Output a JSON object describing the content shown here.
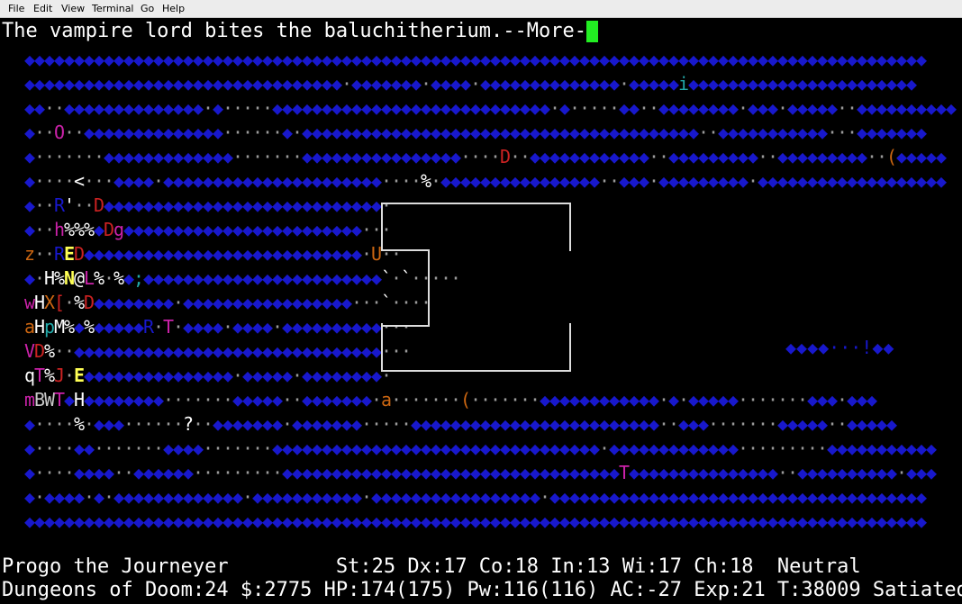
{
  "menu": {
    "items": [
      "File",
      "Edit",
      "View",
      "Terminal",
      "Go",
      "Help"
    ]
  },
  "message": "The vampire lord bites the baluchitherium.--More--",
  "map": {
    "rows": [
      "◆◆◆◆◆◆◆◆◆◆◆◆◆◆◆◆◆◆◆◆◆◆◆◆◆◆◆◆◆◆◆◆◆◆◆◆◆◆◆◆◆◆◆◆◆◆◆◆◆◆◆◆◆◆◆◆◆◆◆◆◆◆◆◆◆◆◆◆◆◆◆◆◆◆◆◆◆◆◆◆◆◆◆◆◆◆◆◆◆◆◆",
      "◆◆◆◆◆◆◆◆◆◆◆◆◆◆◆◆◆◆◆◆◆◆◆◆◆◆◆◆◆◆◆◆·◆◆◆◆◆◆◆·◆◆◆◆·◆◆◆◆◆◆◆◆◆◆◆◆◆◆·◆◆◆◆◆i◆◆◆◆◆◆◆◆◆◆◆◆◆◆◆◆◆◆◆◆◆◆◆",
      "◆◆··◆◆◆◆◆◆◆◆◆◆◆◆◆◆·◆·····◆◆◆◆◆◆◆◆◆◆◆◆◆◆◆◆◆◆◆◆◆◆◆◆◆◆◆◆·◆·····◆◆··◆◆◆◆◆◆◆◆·◆◆◆·◆◆◆◆◆··◆◆◆◆◆◆◆◆◆◆",
      "◆··O··◆◆◆◆◆◆◆◆◆◆◆◆◆◆······◆·◆◆◆◆◆◆◆◆◆◆◆◆◆◆◆◆◆◆◆◆◆◆◆◆◆◆◆◆◆◆◆◆◆◆◆◆◆◆◆◆··◆◆◆◆◆◆◆◆◆◆◆···◆◆◆◆◆◆◆",
      "◆·······◆◆◆◆◆◆◆◆◆◆◆◆◆·······◆◆◆◆◆◆◆◆◆◆◆◆◆◆◆◆····D··◆◆◆◆◆◆◆◆◆◆◆◆··◆◆◆◆◆◆◆◆◆··◆◆◆◆◆◆◆◆◆··(◆◆◆◆◆",
      "◆····<···◆◆◆◆·◆◆◆◆◆◆◆◆◆◆◆◆◆◆◆◆◆◆◆◆◆◆····%·◆◆◆◆◆◆◆◆◆◆◆◆◆◆◆◆··◆◆◆·◆◆◆◆◆◆◆◆◆·◆◆◆◆◆◆◆◆◆◆◆◆◆◆◆◆◆◆◆",
      "◆··R'··D◆◆◆◆◆◆◆◆◆◆◆◆◆◆◆◆◆◆◆◆◆◆◆◆◆◆◆◆·",
      "◆··h%%%◆Dg◆◆◆◆◆◆◆◆◆◆◆◆◆◆◆◆◆◆◆◆◆◆◆◆···",
      "z··RED◆◆◆◆◆◆◆◆◆◆◆◆◆◆◆◆◆◆◆◆◆◆◆◆◆◆◆◆·U··",
      "◆·H%N@L%·%◆;◆◆◆◆◆◆◆◆◆◆◆◆◆◆◆◆◆◆◆◆◆◆◆◆`·`·····",
      "wHX[·%D◆◆◆◆◆◆◆◆·◆◆◆◆◆◆◆◆◆◆◆◆◆◆◆◆◆···`····",
      "aHpM%◆%◆◆◆◆◆R·T·◆◆◆◆·◆◆◆◆·◆◆◆◆◆◆◆◆◆◆···",
      "VD%··◆◆◆◆◆◆◆◆◆◆◆◆◆◆◆◆◆◆◆◆◆◆◆◆◆◆◆◆◆◆◆···",
      "qT%J·E◆◆◆◆◆◆◆◆◆◆◆◆◆◆◆·◆◆◆◆◆·◆◆◆◆◆◆◆◆·",
      "mBWT◆H◆◆◆◆◆◆◆◆·······◆◆◆◆◆··◆◆◆◆◆◆◆·a·······(·······◆◆◆◆◆◆◆◆◆◆◆◆·◆·◆◆◆◆◆·······◆◆◆·◆◆◆",
      "◆····%·◆◆◆······?··◆◆◆◆◆◆◆·◆◆◆◆◆◆◆·····◆◆◆◆◆◆◆◆◆◆◆◆◆◆◆◆◆◆◆◆◆◆◆◆◆··◆◆◆·······◆◆◆◆◆··◆◆◆◆◆",
      "◆····◆◆·······◆◆◆◆·······◆◆◆◆◆◆◆◆◆◆◆◆◆◆◆◆◆◆◆◆◆◆◆◆◆◆◆◆◆◆◆◆◆·◆◆◆◆◆◆◆◆◆◆◆◆◆·········◆◆◆◆◆◆◆◆◆◆◆",
      "◆····◆◆◆◆··◆◆◆◆◆◆·········◆◆◆◆◆◆◆◆◆◆◆◆◆◆◆◆◆◆◆◆◆◆◆◆◆◆◆◆◆◆◆◆◆◆T◆◆◆◆◆◆◆◆◆◆◆◆◆◆◆··◆◆◆◆◆◆◆◆◆◆·◆◆◆",
      "◆·◆◆◆◆·◆·◆◆◆◆◆◆◆◆◆◆◆◆◆·◆◆◆◆◆◆◆◆◆◆◆·◆◆◆◆◆◆◆◆◆◆◆◆◆◆◆◆◆·◆◆◆◆◆◆◆◆◆◆◆◆◆◆◆◆◆◆◆◆◆◆◆◆◆◆◆◆◆◆◆◆◆◆◆◆◆◆",
      "◆◆◆◆◆◆◆◆◆◆◆◆◆◆◆◆◆◆◆◆◆◆◆◆◆◆◆◆◆◆◆◆◆◆◆◆◆◆◆◆◆◆◆◆◆◆◆◆◆◆◆◆◆◆◆◆◆◆◆◆◆◆◆◆◆◆◆◆◆◆◆◆◆◆◆◆◆◆◆◆◆◆◆◆◆◆◆◆◆◆◆"
    ],
    "extra_items": [
      "◆◆◆◆···!◆◆"
    ]
  },
  "status": {
    "line1": "Progo the Journeyer         St:25 Dx:17 Co:18 In:13 Wi:17 Ch:18  Neutral",
    "line2": "Dungeons of Doom:24 $:2775 HP:174(175) Pw:116(116) AC:-27 Exp:21 T:38009 Satiated"
  },
  "colors": {
    "background": "#000000",
    "wall": "#1818cc",
    "cursor": "#22ee22"
  }
}
